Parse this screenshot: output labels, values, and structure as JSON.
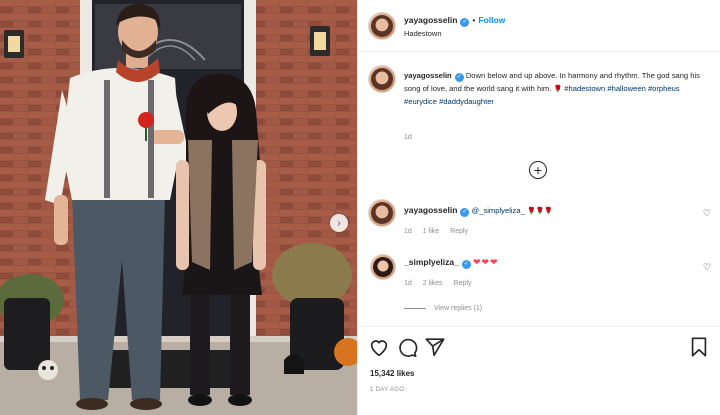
{
  "post": {
    "username": "yayagosselin",
    "follow_label": "Follow",
    "separator": "•",
    "location": "Hadestown"
  },
  "caption": {
    "username": "yayagosselin",
    "text_before_rose": "Down below and up above. In harmony and rhythm. The god sang his song of love, and the world sang it with him.",
    "rose_emoji": "🌹",
    "hashtags": [
      "#hadestown",
      "#halloween",
      "#orpheus",
      "#eurydice",
      "#daddydaughter"
    ],
    "time": "1d"
  },
  "load_more_label": "+",
  "comments": [
    {
      "username": "yayagosselin",
      "mention": "@_simplyeliza_",
      "emojis": "🌹🌹🌹",
      "time": "1d",
      "likes": "1 like",
      "reply": "Reply"
    },
    {
      "username": "_simplyeliza_",
      "emojis": "❤❤❤",
      "time": "1d",
      "likes": "2 likes",
      "reply": "Reply",
      "view_replies": "View replies (1)"
    }
  ],
  "actions": {
    "icons": [
      "heart-icon",
      "comment-icon",
      "share-icon",
      "bookmark-icon"
    ],
    "likes_count": "15,342 likes",
    "posted": "1 DAY AGO"
  },
  "colors": {
    "link": "#0095f6",
    "hashtag": "#00376b",
    "heart": "#ed4956",
    "verified": "#3897f0"
  }
}
